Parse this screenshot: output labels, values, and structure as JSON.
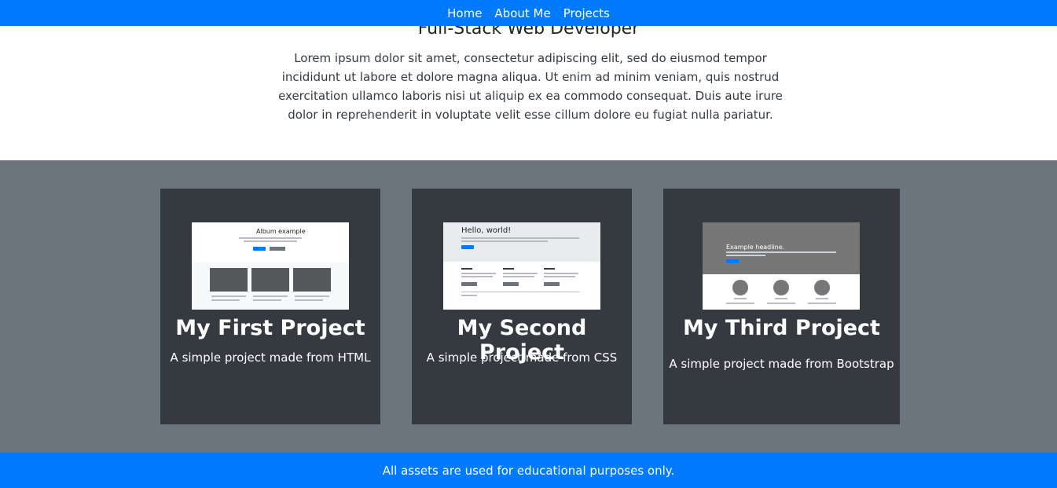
{
  "nav": {
    "items": [
      {
        "label": "Home"
      },
      {
        "label": "About Me"
      },
      {
        "label": "Projects"
      }
    ]
  },
  "hero": {
    "title": "Full-Stack Web Developer",
    "description": "Lorem ipsum dolor sit amet, consectetur adipiscing elit, sed do eiusmod tempor incididunt ut labore et dolore magna aliqua. Ut enim ad minim veniam, quis nostrud exercitation ullamco laboris nisi ut aliquip ex ea commodo consequat. Duis aute irure dolor in reprehenderit in voluptate velit esse cillum dolore eu fugiat nulla pariatur."
  },
  "projects": [
    {
      "title": "My First Project",
      "description": "A simple project made from HTML",
      "thumbnail": {
        "heading": "Album example",
        "card_label": "Thumbnail"
      }
    },
    {
      "title": "My Second Project",
      "description": "A simple project made from CSS",
      "thumbnail": {
        "heading": "Hello, world!",
        "col_label": "Heading"
      }
    },
    {
      "title": "My Third Project",
      "description": "A simple project made from Bootstrap",
      "thumbnail": {
        "heading": "Example headline.",
        "col_label": "Heading"
      }
    }
  ],
  "footer": {
    "text": "All assets are used for educational purposes only."
  },
  "colors": {
    "primary": "#007bff",
    "section_bg": "#6c757d",
    "card_bg": "#343a40"
  }
}
